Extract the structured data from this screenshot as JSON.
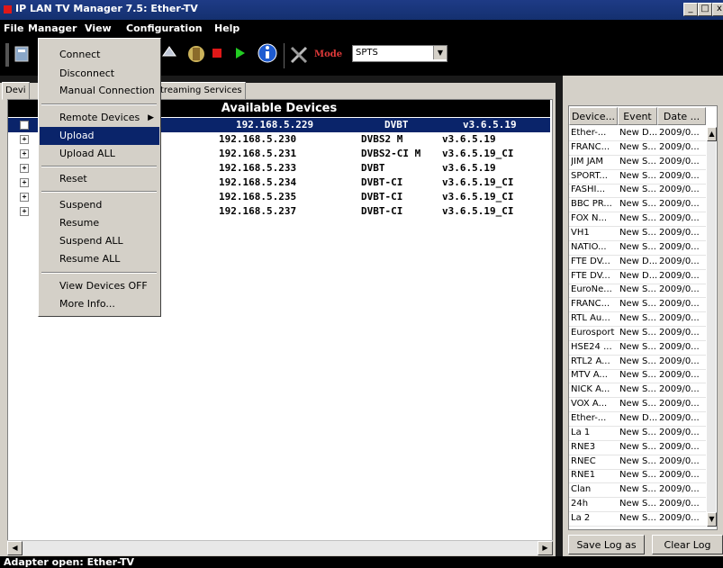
{
  "window": {
    "title": "IP LAN TV Manager 7.5: Ether-TV",
    "min": "_",
    "max": "□",
    "close": "x"
  },
  "menubar": [
    "File",
    "Manager",
    "View",
    "Configuration",
    "Help"
  ],
  "toolbar": {
    "mode_label": "Mode",
    "mode_value": "SPTS"
  },
  "tabs": {
    "devices": "Devi",
    "streaming": "treaming Services"
  },
  "devices": {
    "header": "Available Devices",
    "rows": [
      {
        "ip": "192.168.5.229",
        "type": "DVBT",
        "version": "v3.6.5.19",
        "selected": true
      },
      {
        "ip": "192.168.5.230",
        "type": "DVBS2 M",
        "version": "v3.6.5.19"
      },
      {
        "ip": "192.168.5.231",
        "type": "DVBS2-CI M",
        "version": "v3.6.5.19_CI"
      },
      {
        "ip": "192.168.5.233",
        "type": "DVBT",
        "version": "v3.6.5.19"
      },
      {
        "ip": "192.168.5.234",
        "type": "DVBT-CI",
        "version": "v3.6.5.19_CI"
      },
      {
        "ip": "192.168.5.235",
        "type": "DVBT-CI",
        "version": "v3.6.5.19_CI"
      },
      {
        "ip": "192.168.5.237",
        "type": "DVBT-CI",
        "version": "v3.6.5.19_CI"
      }
    ]
  },
  "manager_menu": {
    "connect": "Connect",
    "disconnect": "Disconnect",
    "manual_connection": "Manual Connection",
    "remote_devices": "Remote Devices",
    "upload": "Upload",
    "upload_all": "Upload ALL",
    "reset": "Reset",
    "suspend": "Suspend",
    "resume": "Resume",
    "suspend_all": "Suspend ALL",
    "resume_all": "Resume ALL",
    "view_devices_off": "View Devices OFF",
    "more_info": "More Info..."
  },
  "log": {
    "columns": [
      "Device...",
      "Event",
      "Date ..."
    ],
    "rows": [
      [
        "Ether-...",
        "New D...",
        "2009/0..."
      ],
      [
        "FRANC...",
        "New S...",
        "2009/0..."
      ],
      [
        "JIM JAM",
        "New S...",
        "2009/0..."
      ],
      [
        "SPORT...",
        "New S...",
        "2009/0..."
      ],
      [
        "FASHI...",
        "New S...",
        "2009/0..."
      ],
      [
        "BBC PR...",
        "New S...",
        "2009/0..."
      ],
      [
        "FOX N...",
        "New S...",
        "2009/0..."
      ],
      [
        "VH1",
        "New S...",
        "2009/0..."
      ],
      [
        "NATIO...",
        "New S...",
        "2009/0..."
      ],
      [
        "FTE DV...",
        "New D...",
        "2009/0..."
      ],
      [
        "FTE DV...",
        "New D...",
        "2009/0..."
      ],
      [
        "EuroNe...",
        "New S...",
        "2009/0..."
      ],
      [
        "FRANC...",
        "New S...",
        "2009/0..."
      ],
      [
        "RTL Au...",
        "New S...",
        "2009/0..."
      ],
      [
        "Eurosport",
        "New S...",
        "2009/0..."
      ],
      [
        "HSE24 ...",
        "New S...",
        "2009/0..."
      ],
      [
        "RTL2 A...",
        "New S...",
        "2009/0..."
      ],
      [
        "MTV A...",
        "New S...",
        "2009/0..."
      ],
      [
        "NICK A...",
        "New S...",
        "2009/0..."
      ],
      [
        "VOX A...",
        "New S...",
        "2009/0..."
      ],
      [
        "Ether-...",
        "New D...",
        "2009/0..."
      ],
      [
        "La 1",
        "New S...",
        "2009/0..."
      ],
      [
        "RNE3",
        "New S...",
        "2009/0..."
      ],
      [
        "RNEC",
        "New S...",
        "2009/0..."
      ],
      [
        "RNE1",
        "New S...",
        "2009/0..."
      ],
      [
        "Clan",
        "New S...",
        "2009/0..."
      ],
      [
        "24h",
        "New S...",
        "2009/0..."
      ],
      [
        "La 2",
        "New S...",
        "2009/0..."
      ]
    ],
    "save_button": "Save Log as",
    "clear_button": "Clear Log"
  },
  "status": {
    "text": "Adapter open: Ether-TV"
  },
  "colors": {
    "selection": "#0a246a",
    "titlebar": "#14306f",
    "chrome": "#d4d0c8"
  }
}
